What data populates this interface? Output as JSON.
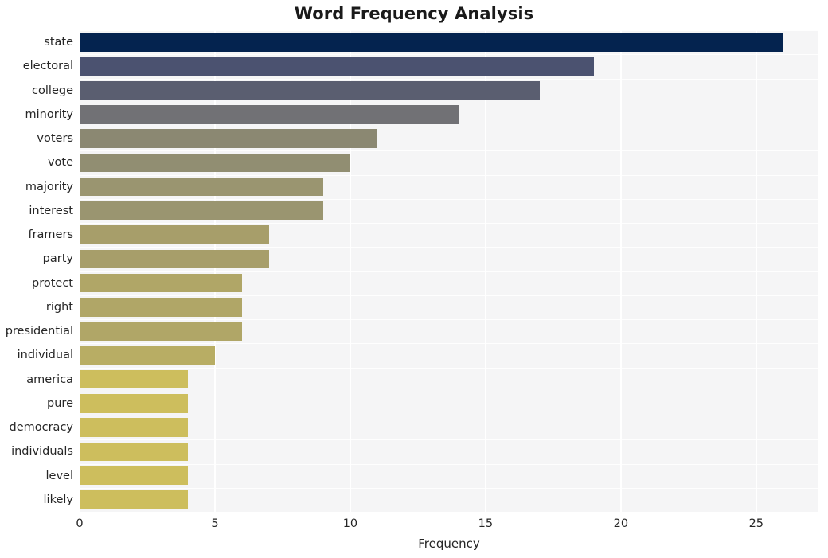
{
  "chart_data": {
    "type": "bar",
    "orientation": "horizontal",
    "title": "Word Frequency Analysis",
    "xlabel": "Frequency",
    "ylabel": "",
    "categories": [
      "state",
      "electoral",
      "college",
      "minority",
      "voters",
      "vote",
      "majority",
      "interest",
      "framers",
      "party",
      "protect",
      "right",
      "presidential",
      "individual",
      "america",
      "pure",
      "democracy",
      "individuals",
      "level",
      "likely"
    ],
    "values": [
      26,
      19,
      17,
      14,
      11,
      10,
      9,
      9,
      7,
      7,
      6,
      6,
      6,
      5,
      4,
      4,
      4,
      4,
      4,
      4
    ],
    "bar_colors": [
      "#04234f",
      "#4b5270",
      "#5a5e70",
      "#717175",
      "#8b8872",
      "#918e72",
      "#9a9570",
      "#9a9570",
      "#a79e6a",
      "#a79e6a",
      "#b0a667",
      "#b0a667",
      "#b0a667",
      "#b8ad64",
      "#cdbe5d",
      "#cdbe5d",
      "#cdbe5d",
      "#cdbe5d",
      "#cdbe5d",
      "#cdbe5d"
    ],
    "xticks": [
      0,
      5,
      10,
      15,
      20,
      25
    ],
    "xtick_labels": [
      "0",
      "5",
      "10",
      "15",
      "20",
      "25"
    ],
    "xlim": [
      0,
      27.3
    ],
    "grid": true,
    "grid_axis": "both",
    "grid_color": "#ffffff",
    "plot_background": "#f5f5f6",
    "figure_background": "#ffffff",
    "legend": null,
    "style": "whitegrid"
  }
}
